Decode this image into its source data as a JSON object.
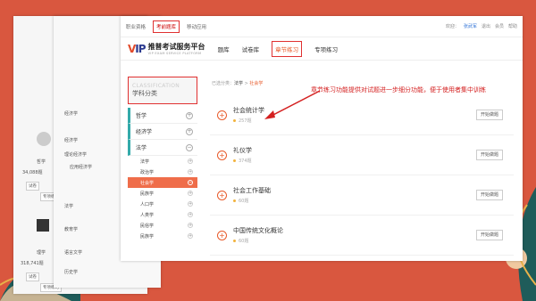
{
  "topnav": {
    "items": [
      "职业资格",
      "考前题库",
      "移动应用"
    ],
    "active_index": 1,
    "user_prefix": "欢迎：",
    "user": "张武军",
    "links": [
      "退出",
      "会员",
      "帮助"
    ]
  },
  "brand": {
    "title": "推普考试服务平台",
    "subtitle": "VIP EXAM SERVICE PLATFORM",
    "tabs": [
      "题库",
      "试卷库",
      "章节练习",
      "专项练习"
    ],
    "active_tab": 2
  },
  "sidebar": {
    "classification_en": "CLASSIFICATION",
    "classification_cn": "学科分类",
    "categories": [
      {
        "label": "哲学"
      },
      {
        "label": "经济学"
      },
      {
        "label": "法学",
        "subs": [
          "法学",
          "政治学",
          "社会学",
          "民族学",
          "人口学",
          "人类学",
          "民俗学",
          "民族学"
        ]
      }
    ],
    "selected_sub": "社会学"
  },
  "breadcrumb": {
    "prefix": "已选分类：",
    "level1": "法学",
    "sep": " > ",
    "level2": "社会学"
  },
  "items": [
    {
      "title": "社会统计学",
      "count": "257题",
      "button": "开始做题"
    },
    {
      "title": "礼仪学",
      "count": "374题",
      "button": "开始做题"
    },
    {
      "title": "社会工作基础",
      "count": "60题",
      "button": "开始做题"
    },
    {
      "title": "中国传统文化概论",
      "count": "60题",
      "button": "开始做题"
    }
  ],
  "annotation": "章节练习功能提供对试题进一步细分功能，便于使用者集中训练",
  "bg_window": {
    "cats": [
      "哲学",
      "理学"
    ],
    "counts": [
      "34,088题",
      "318,741题"
    ],
    "cat2": [
      "经济学",
      "理论经济学",
      "应用经济学",
      "法学",
      "教育学",
      "语言文学",
      "历史学"
    ],
    "btns": [
      "试卷",
      "专项练习"
    ]
  },
  "colors": {
    "accent": "#e85a2a",
    "highlight": "#e03030",
    "background": "#d9573f"
  }
}
